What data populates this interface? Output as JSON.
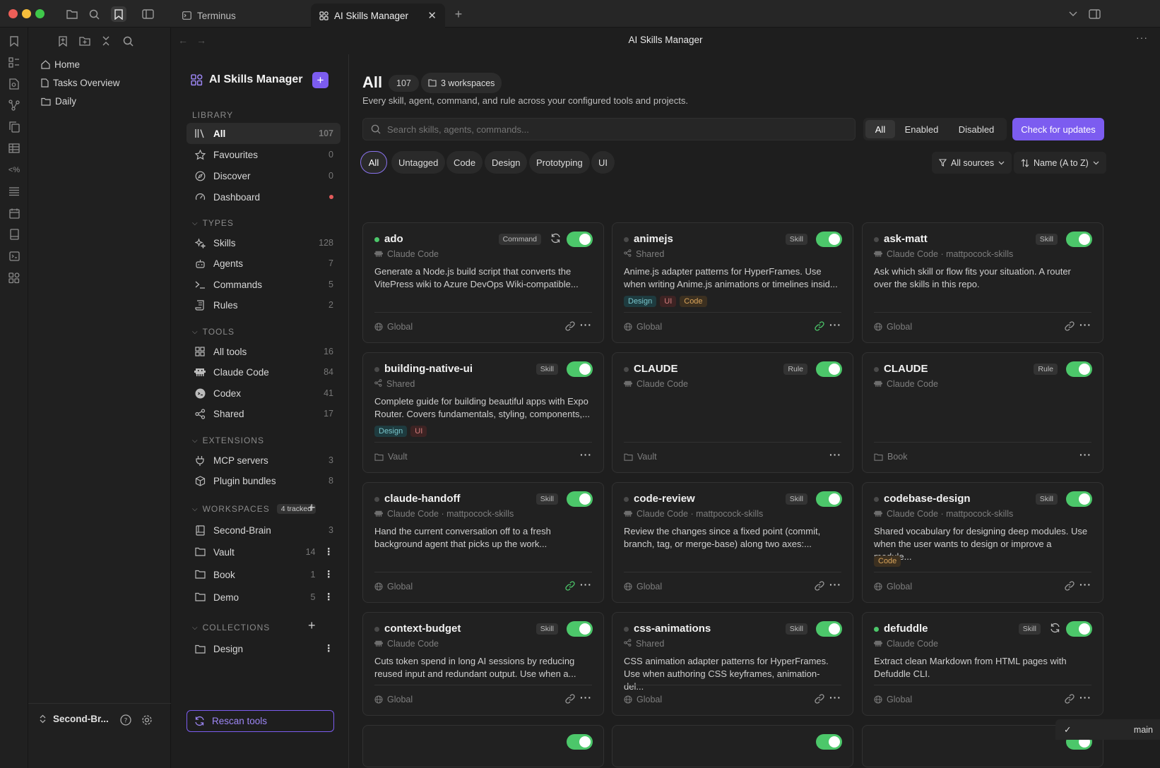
{
  "window": {
    "tabs": [
      {
        "label": "Terminus"
      },
      {
        "label": "AI Skills Manager"
      }
    ],
    "title": "AI Skills Manager"
  },
  "filetree": {
    "items": [
      {
        "label": "Home"
      },
      {
        "label": "Tasks Overview"
      },
      {
        "label": "Daily"
      }
    ],
    "vault_name": "Second-Br..."
  },
  "sidebar": {
    "app_title": "AI Skills Manager",
    "library_header": "LIBRARY",
    "library": [
      {
        "label": "All",
        "count": "107"
      },
      {
        "label": "Favourites",
        "count": "0"
      },
      {
        "label": "Discover",
        "count": "0"
      },
      {
        "label": "Dashboard",
        "count": ""
      }
    ],
    "types_header": "TYPES",
    "types": [
      {
        "label": "Skills",
        "count": "128"
      },
      {
        "label": "Agents",
        "count": "7"
      },
      {
        "label": "Commands",
        "count": "5"
      },
      {
        "label": "Rules",
        "count": "2"
      }
    ],
    "tools_header": "TOOLS",
    "tools": [
      {
        "label": "All tools",
        "count": "16"
      },
      {
        "label": "Claude Code",
        "count": "84"
      },
      {
        "label": "Codex",
        "count": "41"
      },
      {
        "label": "Shared",
        "count": "17"
      }
    ],
    "extensions_header": "EXTENSIONS",
    "extensions": [
      {
        "label": "MCP servers",
        "count": "3"
      },
      {
        "label": "Plugin bundles",
        "count": "8"
      }
    ],
    "workspaces_header": "WORKSPACES",
    "workspaces_badge": "4 tracked",
    "workspaces": [
      {
        "label": "Second-Brain",
        "count": "3"
      },
      {
        "label": "Vault",
        "count": "14"
      },
      {
        "label": "Book",
        "count": "1"
      },
      {
        "label": "Demo",
        "count": "5"
      }
    ],
    "collections_header": "COLLECTIONS",
    "collections": [
      {
        "label": "Design"
      }
    ],
    "rescan_label": "Rescan tools"
  },
  "header": {
    "title": "All",
    "count": "107",
    "workspaces_label": "3 workspaces",
    "subtitle": "Every skill, agent, command, and rule across your configured tools and projects."
  },
  "search": {
    "placeholder": "Search skills, agents, commands..."
  },
  "status_filter": {
    "options": [
      "All",
      "Enabled",
      "Disabled"
    ],
    "selected": "All"
  },
  "update_button": "Check for updates",
  "tag_filters": [
    "All",
    "Untagged",
    "Code",
    "Design",
    "Prototyping",
    "UI"
  ],
  "sources_dropdown": "All sources",
  "sort_dropdown": "Name (A to Z)",
  "cards": [
    {
      "name": "ado",
      "type": "Command",
      "source": "Claude Code",
      "desc1": "Generate a Node.js build script that converts the",
      "desc2": "VitePress wiki to Azure DevOps Wiki-compatible...",
      "tags": [],
      "footer": "Global",
      "enabled": true,
      "active_dot": true,
      "sync": true,
      "link": true,
      "link_green": false
    },
    {
      "name": "animejs",
      "type": "Skill",
      "source": "Shared",
      "desc1": "Anime.js adapter patterns for HyperFrames. Use",
      "desc2": "when writing Anime.js animations or timelines insid...",
      "tags": [
        "Design",
        "UI",
        "Code"
      ],
      "footer": "Global",
      "enabled": true,
      "active_dot": false,
      "sync": false,
      "link": true,
      "link_green": true
    },
    {
      "name": "ask-matt",
      "type": "Skill",
      "source": "Claude Code · mattpocock-skills",
      "desc1": "Ask which skill or flow fits your situation. A router",
      "desc2": "over the skills in this repo.",
      "tags": [],
      "footer": "Global",
      "enabled": true,
      "active_dot": false,
      "sync": false,
      "link": true,
      "link_green": false
    },
    {
      "name": "building-native-ui",
      "type": "Skill",
      "source": "Shared",
      "desc1": "Complete guide for building beautiful apps with Expo",
      "desc2": "Router. Covers fundamentals, styling, components,...",
      "tags": [
        "Design",
        "UI"
      ],
      "footer": "Vault",
      "enabled": true,
      "active_dot": false,
      "sync": false,
      "link": false,
      "link_green": false
    },
    {
      "name": "CLAUDE",
      "type": "Rule",
      "source": "Claude Code",
      "desc1": "",
      "desc2": "",
      "tags": [],
      "footer": "Vault",
      "enabled": true,
      "active_dot": false,
      "sync": false,
      "link": false,
      "link_green": false
    },
    {
      "name": "CLAUDE",
      "type": "Rule",
      "source": "Claude Code",
      "desc1": "",
      "desc2": "",
      "tags": [],
      "footer": "Book",
      "enabled": true,
      "active_dot": false,
      "sync": false,
      "link": false,
      "link_green": false
    },
    {
      "name": "claude-handoff",
      "type": "Skill",
      "source": "Claude Code · mattpocock-skills",
      "desc1": "Hand the current conversation off to a fresh",
      "desc2": "background agent that picks up the work...",
      "tags": [],
      "footer": "Global",
      "enabled": true,
      "active_dot": false,
      "sync": false,
      "link": true,
      "link_green": true
    },
    {
      "name": "code-review",
      "type": "Skill",
      "source": "Claude Code · mattpocock-skills",
      "desc1": "Review the changes since a fixed point (commit,",
      "desc2": "branch, tag, or merge-base) along two axes:...",
      "tags": [],
      "footer": "Global",
      "enabled": true,
      "active_dot": false,
      "sync": false,
      "link": true,
      "link_green": false
    },
    {
      "name": "codebase-design",
      "type": "Skill",
      "source": "Claude Code · mattpocock-skills",
      "desc1": "Shared vocabulary for designing deep modules. Use",
      "desc2": "when the user wants to design or improve a module...",
      "tags": [
        "Code"
      ],
      "footer": "Global",
      "enabled": true,
      "active_dot": false,
      "sync": false,
      "link": true,
      "link_green": false
    },
    {
      "name": "context-budget",
      "type": "Skill",
      "source": "Claude Code",
      "desc1": "Cuts token spend in long AI sessions by reducing",
      "desc2": "reused input and redundant output. Use when a...",
      "tags": [],
      "footer": "Global",
      "enabled": true,
      "active_dot": false,
      "sync": false,
      "link": true,
      "link_green": false
    },
    {
      "name": "css-animations",
      "type": "Skill",
      "source": "Shared",
      "desc1": "CSS animation adapter patterns for HyperFrames.",
      "desc2": "Use when authoring CSS keyframes, animation-del...",
      "tags": [],
      "footer": "Global",
      "enabled": true,
      "active_dot": false,
      "sync": false,
      "link": true,
      "link_green": false
    },
    {
      "name": "defuddle",
      "type": "Skill",
      "source": "Claude Code",
      "desc1": "Extract clean Markdown from HTML pages with",
      "desc2": "Defuddle CLI.",
      "tags": [],
      "footer": "Global",
      "enabled": true,
      "active_dot": true,
      "sync": true,
      "link": true,
      "link_green": false
    }
  ],
  "statusbar": {
    "branch": "main"
  },
  "colors": {
    "accent": "#7c5cf0",
    "enabled_green": "#4cc76a",
    "background": "#1e1e1e"
  }
}
